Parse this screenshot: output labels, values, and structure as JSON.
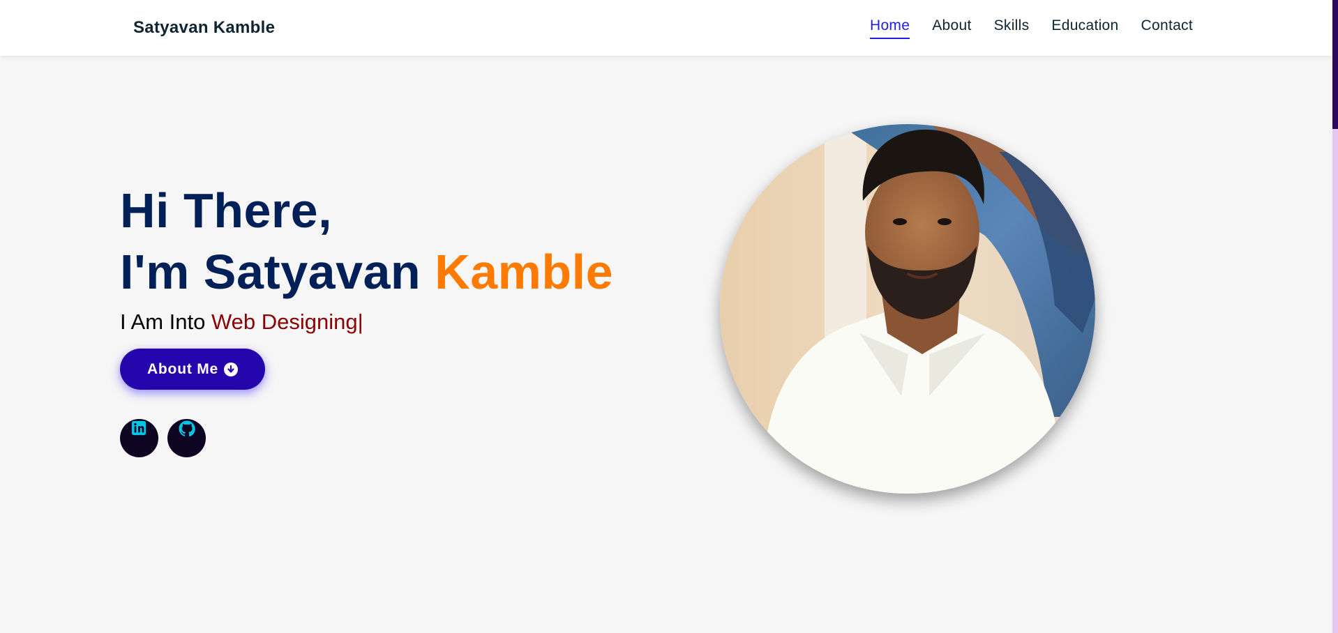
{
  "nav": {
    "brand": "Satyavan Kamble",
    "links": [
      "Home",
      "About",
      "Skills",
      "Education",
      "Contact"
    ],
    "active": "Home"
  },
  "hero": {
    "greeting": "Hi There,",
    "intro_prefix": "I'm Satyavan",
    "intro_highlight": "Kamble",
    "typed_prefix": "I Am Into",
    "typed_role": "Web Designing",
    "typed_cursor": "|",
    "about_button": "About Me",
    "about_button_icon": "arrow-circle-down-icon"
  },
  "socials": [
    {
      "name": "linkedin",
      "icon": "linkedin-icon"
    },
    {
      "name": "github",
      "icon": "github-icon"
    }
  ],
  "colors": {
    "heading": "#002057",
    "accent": "#ff7b00",
    "role": "#8b0000",
    "button": "#2506ad",
    "nav_active": "#1e1ee6",
    "social_bg": "#0e0523",
    "social_icon": "#00c6e6"
  }
}
